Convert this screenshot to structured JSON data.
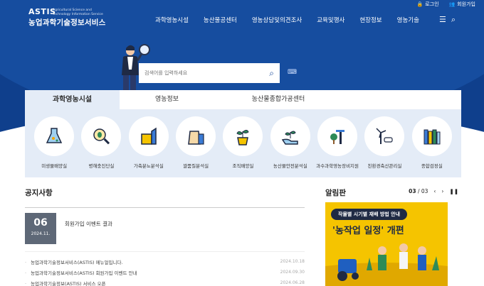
{
  "util": {
    "login": "로그인",
    "join": "회원가입"
  },
  "logo": {
    "mark": "ASTIS",
    "sub1": "Agricultural Science and",
    "sub2": "Technology Information Service",
    "name": "농업과학기술정보서비스"
  },
  "gnb": [
    "과학영농시설",
    "농산물공센터",
    "영농상담및의견조사",
    "교육및행사",
    "현장정보",
    "영농기술"
  ],
  "search": {
    "placeholder": "검색어를 입력하세요"
  },
  "tabs": [
    "과학영농시설",
    "영농정보",
    "농산물종합가공센터"
  ],
  "facilities": [
    {
      "label": "미생물배양실",
      "icon": "microbe-flask-icon"
    },
    {
      "label": "병해충진단실",
      "icon": "bug-magnifier-icon"
    },
    {
      "label": "가축분뇨분석실",
      "icon": "livestock-manure-icon"
    },
    {
      "label": "쌀품질분석실",
      "icon": "rice-bag-icon"
    },
    {
      "label": "조직배양실",
      "icon": "sprout-pot-icon"
    },
    {
      "label": "농산물안전분석실",
      "icon": "hand-plant-icon"
    },
    {
      "label": "과수과학영농장비지원",
      "icon": "orchard-sensor-icon"
    },
    {
      "label": "친환경축산관리실",
      "icon": "windmill-cow-icon"
    },
    {
      "label": "종합검정실",
      "icon": "books-icon"
    }
  ],
  "notice": {
    "title": "공지사항",
    "featured": {
      "day": "06",
      "ym": "2024.11.",
      "title": "회원가입 이벤트 결과"
    },
    "items": [
      {
        "title": "농업과학기술정보서비스(ASTIS) 메뉴얼입니다.",
        "date": "2024.10.18"
      },
      {
        "title": "농업과학기술정보서비스(ASTIS) 회원가입 이벤트 안내",
        "date": "2024.09.30"
      },
      {
        "title": "농업과학기술정보(ASTIS) 서비스 오픈",
        "date": "2024.06.28"
      }
    ]
  },
  "board": {
    "title": "알림판",
    "page": "03",
    "total": "/ 03",
    "banner_line1": "작물별 시기별 재배 방법 안내",
    "banner_line2": "'농작업 일정' 개편"
  },
  "colors": {
    "navy": "#0f3f8c",
    "panel": "#e4ecf7",
    "banner": "#f5c400"
  }
}
